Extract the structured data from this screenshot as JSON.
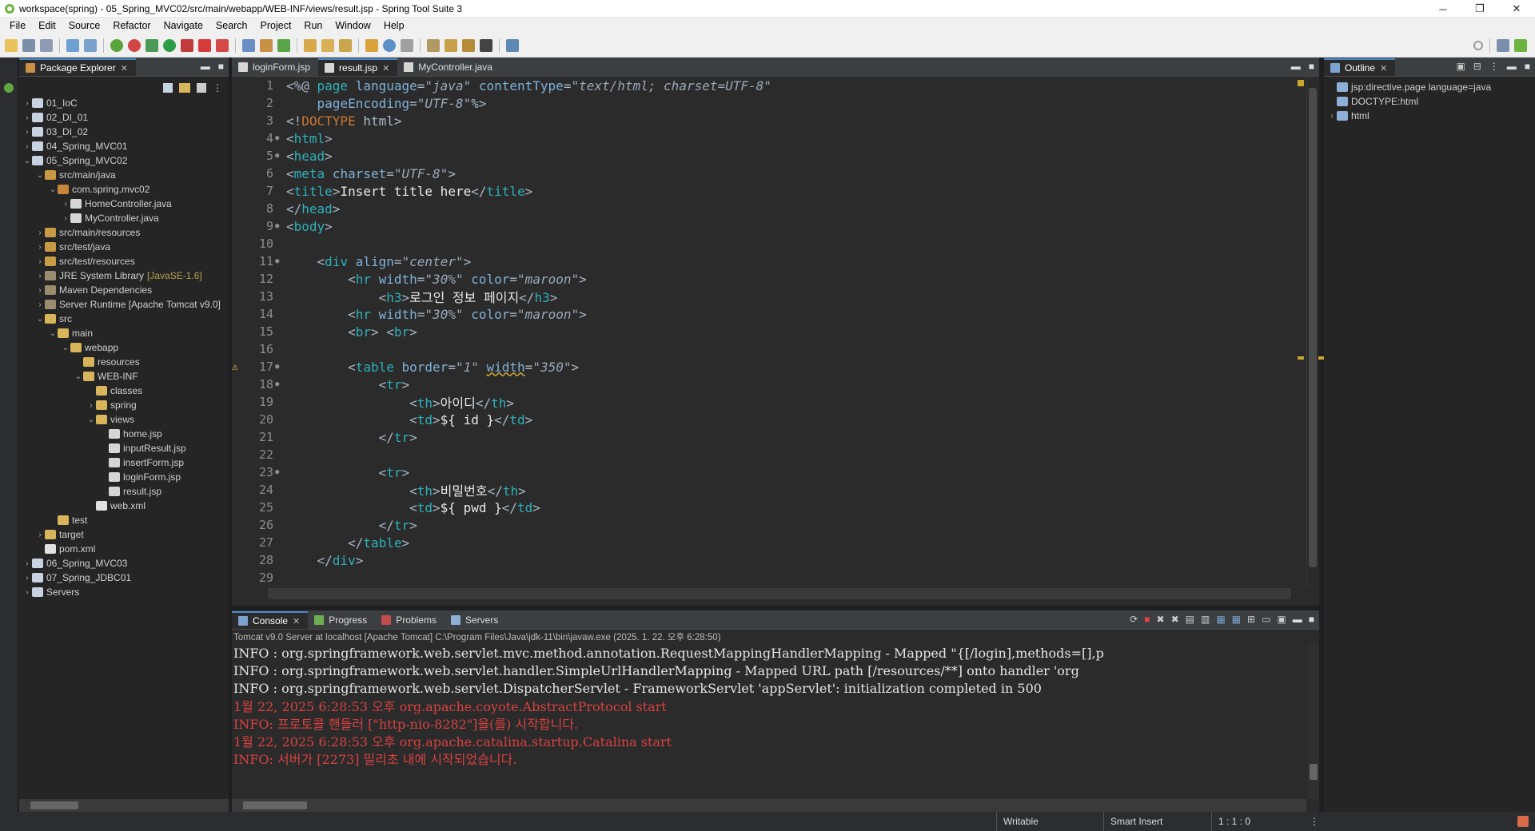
{
  "window": {
    "title": "workspace(spring) - 05_Spring_MVC02/src/main/webapp/WEB-INF/views/result.jsp - Spring Tool Suite 3"
  },
  "menu": [
    "File",
    "Edit",
    "Source",
    "Refactor",
    "Navigate",
    "Search",
    "Project",
    "Run",
    "Window",
    "Help"
  ],
  "package_explorer": {
    "tab_label": "Package Explorer",
    "tree": [
      {
        "label": "01_IoC",
        "depth": 0,
        "arrow": "›",
        "color": "#c9d2e0"
      },
      {
        "label": "02_DI_01",
        "depth": 0,
        "arrow": "›",
        "color": "#c9d2e0"
      },
      {
        "label": "03_DI_02",
        "depth": 0,
        "arrow": "›",
        "color": "#c9d2e0"
      },
      {
        "label": "04_Spring_MVC01",
        "depth": 0,
        "arrow": "›",
        "color": "#c9d2e0"
      },
      {
        "label": "05_Spring_MVC02",
        "depth": 0,
        "arrow": "⌄",
        "color": "#c9d2e0"
      },
      {
        "label": "src/main/java",
        "depth": 1,
        "arrow": "⌄",
        "color": "#c99a46"
      },
      {
        "label": "com.spring.mvc02",
        "depth": 2,
        "arrow": "⌄",
        "color": "#c9853a"
      },
      {
        "label": "HomeController.java",
        "depth": 3,
        "arrow": "›",
        "color": "#d6d6d6"
      },
      {
        "label": "MyController.java",
        "depth": 3,
        "arrow": "›",
        "color": "#d6d6d6"
      },
      {
        "label": "src/main/resources",
        "depth": 1,
        "arrow": "›",
        "color": "#c99a46"
      },
      {
        "label": "src/test/java",
        "depth": 1,
        "arrow": "›",
        "color": "#c99a46"
      },
      {
        "label": "src/test/resources",
        "depth": 1,
        "arrow": "›",
        "color": "#c99a46"
      },
      {
        "label": "JRE System Library",
        "depth": 1,
        "arrow": "›",
        "color": "#9a8c6e",
        "deco": "[JavaSE-1.6]"
      },
      {
        "label": "Maven Dependencies",
        "depth": 1,
        "arrow": "›",
        "color": "#9a8c6e"
      },
      {
        "label": "Server Runtime [Apache Tomcat v9.0]",
        "depth": 1,
        "arrow": "›",
        "color": "#9a8c6e"
      },
      {
        "label": "src",
        "depth": 1,
        "arrow": "⌄",
        "color": "#d8b45a"
      },
      {
        "label": "main",
        "depth": 2,
        "arrow": "⌄",
        "color": "#d8b45a"
      },
      {
        "label": "webapp",
        "depth": 3,
        "arrow": "⌄",
        "color": "#d8b45a"
      },
      {
        "label": "resources",
        "depth": 4,
        "arrow": "",
        "color": "#d8b45a"
      },
      {
        "label": "WEB-INF",
        "depth": 4,
        "arrow": "⌄",
        "color": "#d8b45a"
      },
      {
        "label": "classes",
        "depth": 5,
        "arrow": "",
        "color": "#d8b45a"
      },
      {
        "label": "spring",
        "depth": 5,
        "arrow": "›",
        "color": "#d8b45a"
      },
      {
        "label": "views",
        "depth": 5,
        "arrow": "⌄",
        "color": "#d8b45a"
      },
      {
        "label": "home.jsp",
        "depth": 6,
        "arrow": "",
        "color": "#d6d6d6"
      },
      {
        "label": "inputResult.jsp",
        "depth": 6,
        "arrow": "",
        "color": "#d6d6d6"
      },
      {
        "label": "insertForm.jsp",
        "depth": 6,
        "arrow": "",
        "color": "#d6d6d6"
      },
      {
        "label": "loginForm.jsp",
        "depth": 6,
        "arrow": "",
        "color": "#d6d6d6"
      },
      {
        "label": "result.jsp",
        "depth": 6,
        "arrow": "",
        "color": "#d6d6d6"
      },
      {
        "label": "web.xml",
        "depth": 5,
        "arrow": "",
        "color": "#e0e0e0"
      },
      {
        "label": "test",
        "depth": 2,
        "arrow": "",
        "color": "#d8b45a"
      },
      {
        "label": "target",
        "depth": 1,
        "arrow": "›",
        "color": "#d8b45a"
      },
      {
        "label": "pom.xml",
        "depth": 1,
        "arrow": "",
        "color": "#e0e0e0"
      },
      {
        "label": "06_Spring_MVC03",
        "depth": 0,
        "arrow": "›",
        "color": "#c9d2e0"
      },
      {
        "label": "07_Spring_JDBC01",
        "depth": 0,
        "arrow": "›",
        "color": "#c9d2e0"
      },
      {
        "label": "Servers",
        "depth": 0,
        "arrow": "›",
        "color": "#c9d2e0"
      }
    ]
  },
  "editor": {
    "tabs": [
      {
        "label": "loginForm.jsp",
        "active": false
      },
      {
        "label": "result.jsp",
        "active": true
      },
      {
        "label": "MyController.java",
        "active": false
      }
    ],
    "lines": [
      {
        "n": "1",
        "fold": "",
        "html": "<span class='gy'>&lt;%@ </span><span class='tg'>page</span> <span class='an'>language</span><span class='gy'>=</span><span class='av'>\"java\"</span> <span class='an'>contentType</span><span class='gy'>=</span><span class='av'>\"text/html; charset=UTF-8\"</span>"
      },
      {
        "n": "2",
        "fold": "",
        "html": "    <span class='an'>pageEncoding</span><span class='gy'>=</span><span class='av'>\"UTF-8\"</span><span class='gy'>%&gt;</span>"
      },
      {
        "n": "3",
        "fold": "",
        "html": "<span class='gy'>&lt;!</span><span class='tg2'>DOCTYPE</span> <span class='gy'>html&gt;</span>"
      },
      {
        "n": "4",
        "fold": "●",
        "html": "<span class='gy'>&lt;</span><span class='tg'>html</span><span class='gy'>&gt;</span>"
      },
      {
        "n": "5",
        "fold": "●",
        "html": "<span class='gy'>&lt;</span><span class='tg'>head</span><span class='gy'>&gt;</span>"
      },
      {
        "n": "6",
        "fold": "",
        "html": "<span class='gy'>&lt;</span><span class='tg'>meta</span> <span class='an'>charset</span><span class='gy'>=</span><span class='av'>\"UTF-8\"</span><span class='gy'>&gt;</span>"
      },
      {
        "n": "7",
        "fold": "",
        "html": "<span class='gy'>&lt;</span><span class='tg'>title</span><span class='gy'>&gt;</span>Insert title here<span class='gy'>&lt;/</span><span class='tg'>title</span><span class='gy'>&gt;</span>"
      },
      {
        "n": "8",
        "fold": "",
        "html": "<span class='gy'>&lt;/</span><span class='tg'>head</span><span class='gy'>&gt;</span>"
      },
      {
        "n": "9",
        "fold": "●",
        "html": "<span class='gy'>&lt;</span><span class='tg'>body</span><span class='gy'>&gt;</span>"
      },
      {
        "n": "10",
        "fold": "",
        "html": ""
      },
      {
        "n": "11",
        "fold": "●",
        "html": "    <span class='gy'>&lt;</span><span class='tg'>div</span> <span class='an'>align</span><span class='gy'>=</span><span class='av'>\"center\"</span><span class='gy'>&gt;</span>"
      },
      {
        "n": "12",
        "fold": "",
        "html": "        <span class='gy'>&lt;</span><span class='tg'>hr</span> <span class='an'>width</span><span class='gy'>=</span><span class='av'>\"30%\"</span> <span class='an'>color</span><span class='gy'>=</span><span class='av'>\"maroon\"</span><span class='gy'>&gt;</span>"
      },
      {
        "n": "13",
        "fold": "",
        "html": "            <span class='gy'>&lt;</span><span class='tg'>h3</span><span class='gy'>&gt;</span>로그인 정보 페이지<span class='gy'>&lt;/</span><span class='tg'>h3</span><span class='gy'>&gt;</span>"
      },
      {
        "n": "14",
        "fold": "",
        "html": "        <span class='gy'>&lt;</span><span class='tg'>hr</span> <span class='an'>width</span><span class='gy'>=</span><span class='av'>\"30%\"</span> <span class='an'>color</span><span class='gy'>=</span><span class='av'>\"maroon\"</span><span class='gy'>&gt;</span>"
      },
      {
        "n": "15",
        "fold": "",
        "html": "        <span class='gy'>&lt;</span><span class='tg'>br</span><span class='gy'>&gt;</span> <span class='gy'>&lt;</span><span class='tg'>br</span><span class='gy'>&gt;</span>"
      },
      {
        "n": "16",
        "fold": "",
        "html": ""
      },
      {
        "n": "17",
        "fold": "●",
        "warn": true,
        "html": "        <span class='gy'>&lt;</span><span class='tg'>table</span> <span class='an'>border</span><span class='gy'>=</span><span class='av'>\"1\"</span> <span class='an' style='text-decoration:underline wavy #c8a62e'>width</span><span class='gy'>=</span><span class='av'>\"350\"</span><span class='gy'>&gt;</span>"
      },
      {
        "n": "18",
        "fold": "●",
        "html": "            <span class='gy'>&lt;</span><span class='tg'>tr</span><span class='gy'>&gt;</span>"
      },
      {
        "n": "19",
        "fold": "",
        "html": "                <span class='gy'>&lt;</span><span class='tg'>th</span><span class='gy'>&gt;</span>아이디<span class='gy'>&lt;/</span><span class='tg'>th</span><span class='gy'>&gt;</span>"
      },
      {
        "n": "20",
        "fold": "",
        "html": "                <span class='gy'>&lt;</span><span class='tg'>td</span><span class='gy'>&gt;</span>${ id }<span class='gy'>&lt;/</span><span class='tg'>td</span><span class='gy'>&gt;</span>"
      },
      {
        "n": "21",
        "fold": "",
        "html": "            <span class='gy'>&lt;/</span><span class='tg'>tr</span><span class='gy'>&gt;</span>"
      },
      {
        "n": "22",
        "fold": "",
        "html": ""
      },
      {
        "n": "23",
        "fold": "●",
        "html": "            <span class='gy'>&lt;</span><span class='tg'>tr</span><span class='gy'>&gt;</span>"
      },
      {
        "n": "24",
        "fold": "",
        "html": "                <span class='gy'>&lt;</span><span class='tg'>th</span><span class='gy'>&gt;</span>비밀번호<span class='gy'>&lt;/</span><span class='tg'>th</span><span class='gy'>&gt;</span>"
      },
      {
        "n": "25",
        "fold": "",
        "html": "                <span class='gy'>&lt;</span><span class='tg'>td</span><span class='gy'>&gt;</span>${ pwd }<span class='gy'>&lt;/</span><span class='tg'>td</span><span class='gy'>&gt;</span>"
      },
      {
        "n": "26",
        "fold": "",
        "html": "            <span class='gy'>&lt;/</span><span class='tg'>tr</span><span class='gy'>&gt;</span>"
      },
      {
        "n": "27",
        "fold": "",
        "html": "        <span class='gy'>&lt;/</span><span class='tg'>table</span><span class='gy'>&gt;</span>"
      },
      {
        "n": "28",
        "fold": "",
        "html": "    <span class='gy'>&lt;/</span><span class='tg'>div</span><span class='gy'>&gt;</span>"
      },
      {
        "n": "29",
        "fold": "",
        "html": ""
      }
    ]
  },
  "outline": {
    "tab_label": "Outline",
    "items": [
      {
        "label": "jsp:directive.page language=java",
        "depth": 0,
        "arrow": ""
      },
      {
        "label": "DOCTYPE:html",
        "depth": 0,
        "arrow": ""
      },
      {
        "label": "html",
        "depth": 0,
        "arrow": "›"
      }
    ]
  },
  "console": {
    "tabs": [
      {
        "label": "Console",
        "active": true
      },
      {
        "label": "Progress",
        "active": false
      },
      {
        "label": "Problems",
        "active": false
      },
      {
        "label": "Servers",
        "active": false
      }
    ],
    "path": "Tomcat v9.0 Server at localhost [Apache Tomcat] C:\\Program Files\\Java\\jdk-11\\bin\\javaw.exe  (2025. 1. 22. 오후 6:28:50)",
    "lines": [
      {
        "type": "info",
        "text": "INFO : org.springframework.web.servlet.mvc.method.annotation.RequestMappingHandlerMapping - Mapped \"{[/login],methods=[],p"
      },
      {
        "type": "info",
        "text": "INFO : org.springframework.web.servlet.handler.SimpleUrlHandlerMapping - Mapped URL path [/resources/**] onto handler 'org"
      },
      {
        "type": "info",
        "text": "INFO : org.springframework.web.servlet.DispatcherServlet - FrameworkServlet 'appServlet': initialization completed in 500"
      },
      {
        "type": "red",
        "text": "1월 22, 2025 6:28:53 오후 org.apache.coyote.AbstractProtocol start"
      },
      {
        "type": "red",
        "text": "INFO: 프로토콜 핸들러 [\"http-nio-8282\"]을(를) 시작합니다."
      },
      {
        "type": "red",
        "text": "1월 22, 2025 6:28:53 오후 org.apache.catalina.startup.Catalina start"
      },
      {
        "type": "red",
        "text": "INFO: 서버가 [2273] 밀리초 내에 시작되었습니다."
      }
    ]
  },
  "status": {
    "writable": "Writable",
    "insert_mode": "Smart Insert",
    "position": "1 : 1 : 0"
  }
}
